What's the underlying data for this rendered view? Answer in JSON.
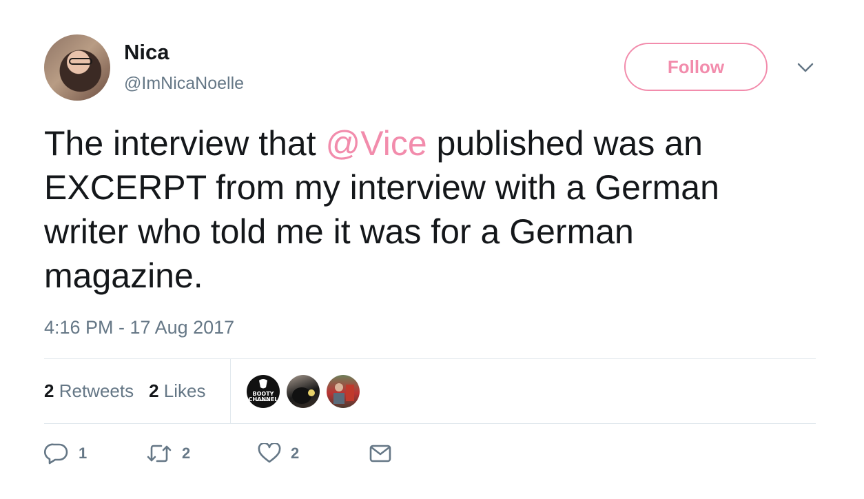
{
  "user": {
    "name": "Nica",
    "handle": "@ImNicaNoelle",
    "follow_label": "Follow"
  },
  "tweet": {
    "text_before": "The interview that ",
    "mention": "@Vice",
    "text_after": " published was an\nEXCERPT from my interview with a German\nwriter who told me it was for a German\nmagazine.",
    "timestamp": "4:16 PM - 17 Aug 2017"
  },
  "stats": {
    "retweets_count": "2",
    "retweets_label": "Retweets",
    "likes_count": "2",
    "likes_label": "Likes",
    "likers": [
      {
        "icon": "booty-channel-avatar",
        "logo_text": "BOOTY CHANNEL"
      },
      {
        "icon": "dog-avatar"
      },
      {
        "icon": "user-avatar"
      }
    ]
  },
  "actions": {
    "reply_count": "1",
    "retweet_count": "2",
    "like_count": "2"
  },
  "colors": {
    "accent": "#f28cac",
    "secondary_text": "#657786",
    "primary_text": "#14171a",
    "divider": "#e1e8ed"
  }
}
